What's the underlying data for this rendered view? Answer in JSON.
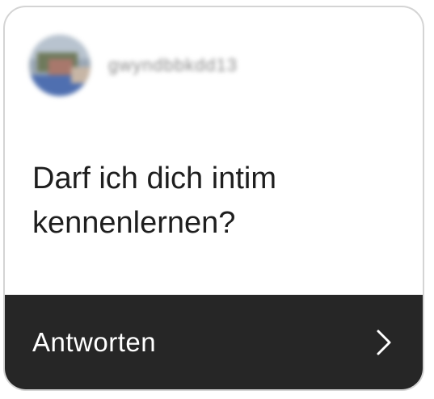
{
  "card": {
    "username": "gwyndbbkdd13",
    "question": "Darf ich dich intim kennenlernen?",
    "reply_label": "Antworten",
    "chevron_icon": "chevron-right-icon",
    "avatar_icon": "profile-photo"
  },
  "colors": {
    "footer_bg": "#262626",
    "question_text": "#1e1e1e",
    "username_text": "#8a8a8a",
    "border": "#d4d4d4"
  }
}
